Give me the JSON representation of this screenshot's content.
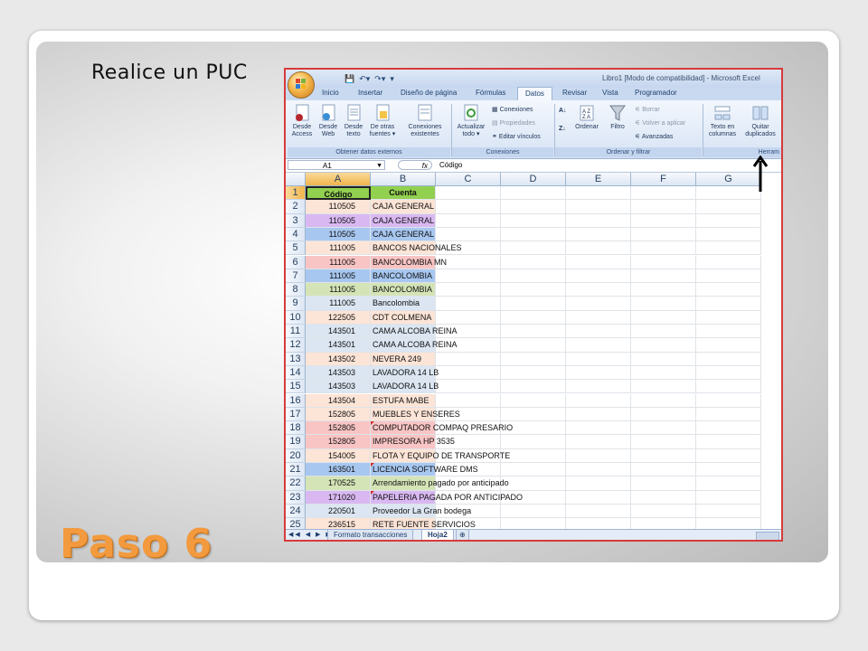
{
  "slide": {
    "instruction": "Realice un PUC",
    "step_title": "Paso 6"
  },
  "excel": {
    "window_title": "Libro1 [Modo de compatibilidad] - Microsoft Excel",
    "tabs": [
      "Inicio",
      "Insertar",
      "Diseño de página",
      "Fórmulas",
      "Datos",
      "Revisar",
      "Vista",
      "Programador"
    ],
    "active_tab": "Datos",
    "ribbon": {
      "desde_access": [
        "Desde",
        "Access"
      ],
      "desde_web": [
        "Desde",
        "Web"
      ],
      "desde_texto": [
        "Desde",
        "texto"
      ],
      "otras_fuentes": [
        "De otras",
        "fuentes ▾"
      ],
      "conexiones_existentes": [
        "Conexiones",
        "existentes"
      ],
      "group_obtener": "Obtener datos externos",
      "actualizar_todo": [
        "Actualizar",
        "todo ▾"
      ],
      "conexiones": "Conexiones",
      "propiedades": "Propiedades",
      "editar_vinculos": "Editar vínculos",
      "group_conexiones": "Conexiones",
      "ordenar": "Ordenar",
      "filtro": "Filtro",
      "borrar": "Borrar",
      "volver_aplicar": "Volver a aplicar",
      "avanzadas": "Avanzadas",
      "group_ordenar": "Ordenar y filtrar",
      "texto_columnas": [
        "Texto en",
        "columnas"
      ],
      "quitar_duplicados": [
        "Quitar",
        "duplicados"
      ],
      "group_herram": "Herram"
    },
    "name_box": "A1",
    "fx": "fx",
    "formula": "Código",
    "columns": [
      "A",
      "B",
      "C",
      "D",
      "E",
      "F",
      "G"
    ],
    "header_row": {
      "code": "Código",
      "account": "Cuenta"
    },
    "rows": [
      {
        "n": "2",
        "code": "110505",
        "account": "CAJA GENERAL",
        "color": "#fce4d6"
      },
      {
        "n": "3",
        "code": "110505",
        "account": "CAJA GENERAL",
        "color": "#d9b8f2"
      },
      {
        "n": "4",
        "code": "110505",
        "account": "CAJA GENERAL",
        "color": "#a7c7f0"
      },
      {
        "n": "5",
        "code": "111005",
        "account": "BANCOS NACIONALES",
        "color": "#fce4d6"
      },
      {
        "n": "6",
        "code": "111005",
        "account": "BANCOLOMBIA MN",
        "color": "#f8c4c4"
      },
      {
        "n": "7",
        "code": "111005",
        "account": "BANCOLOMBIA",
        "color": "#a7c7f0"
      },
      {
        "n": "8",
        "code": "111005",
        "account": "BANCOLOMBIA",
        "color": "#d4e4b6"
      },
      {
        "n": "9",
        "code": "111005",
        "account": "Bancolombia",
        "color": "#dce6f2"
      },
      {
        "n": "10",
        "code": "122505",
        "account": "CDT COLMENA",
        "color": "#fce4d6"
      },
      {
        "n": "11",
        "code": "143501",
        "account": "CAMA ALCOBA REINA",
        "color": "#dce6f2"
      },
      {
        "n": "12",
        "code": "143501",
        "account": "CAMA ALCOBA REINA",
        "color": "#dce6f2"
      },
      {
        "n": "13",
        "code": "143502",
        "account": "NEVERA 249",
        "color": "#fce4d6"
      },
      {
        "n": "14",
        "code": "143503",
        "account": "LAVADORA 14 LB",
        "color": "#dce6f2"
      },
      {
        "n": "15",
        "code": "143503",
        "account": "LAVADORA 14 LB",
        "color": "#dce6f2"
      },
      {
        "n": "16",
        "code": "143504",
        "account": "ESTUFA MABE",
        "color": "#fce4d6"
      },
      {
        "n": "17",
        "code": "152805",
        "account": "MUEBLES Y ENSERES",
        "color": "#fce4d6"
      },
      {
        "n": "18",
        "code": "152805",
        "account": "COMPUTADOR COMPAQ PRESARIO",
        "color": "#f8c4c4"
      },
      {
        "n": "19",
        "code": "152805",
        "account": "IMPRESORA HP 3535",
        "color": "#f8c4c4"
      },
      {
        "n": "20",
        "code": "154005",
        "account": "FLOTA Y EQUIPO DE TRANSPORTE",
        "color": "#fce4d6"
      },
      {
        "n": "21",
        "code": "163501",
        "account": "LICENCIA SOFTWARE DMS",
        "color": "#a7c7f0"
      },
      {
        "n": "22",
        "code": "170525",
        "account": "Arrendamiento pagado por anticipado",
        "color": "#d4e4b6"
      },
      {
        "n": "23",
        "code": "171020",
        "account": "PAPELERIA PAGADA POR ANTICIPADO",
        "color": "#d9b8f2"
      },
      {
        "n": "24",
        "code": "220501",
        "account": "Proveedor La Gran bodega",
        "color": "#dce6f2"
      },
      {
        "n": "25",
        "code": "236515",
        "account": "RETE FUENTE SERVICIOS",
        "color": "#fce4d6"
      }
    ],
    "comment_marker_rows": [
      "18",
      "21",
      "23"
    ],
    "sheet_tabs": [
      "Formato transacciones",
      "Hoja2"
    ],
    "active_sheet": "Hoja2",
    "nav_buttons": "◀◀ ◀ ▶ ▶▶"
  },
  "colors": {
    "frame_border": "#d83a3a",
    "header_green": "#92d050",
    "title_orange": "#f29a3d"
  }
}
